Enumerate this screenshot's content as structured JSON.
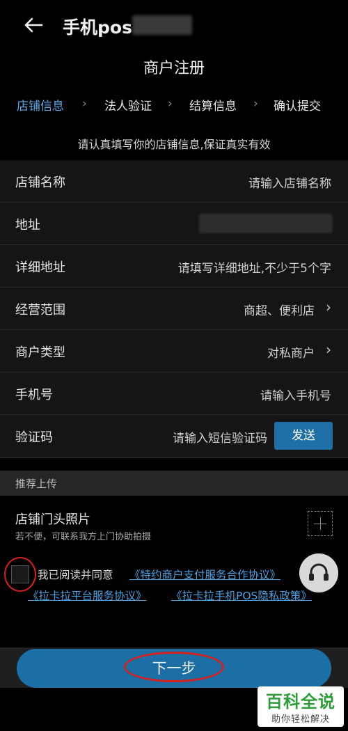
{
  "header": {
    "app_title": "手机pos",
    "page_title": "商户注册"
  },
  "steps": [
    {
      "label": "店铺信息",
      "active": true
    },
    {
      "label": "法人验证",
      "active": false
    },
    {
      "label": "结算信息",
      "active": false
    },
    {
      "label": "确认提交",
      "active": false
    }
  ],
  "hint": "请认真填写你的店铺信息,保证真实有效",
  "form": {
    "store_name": {
      "label": "店铺名称",
      "placeholder": "请输入店铺名称"
    },
    "address": {
      "label": "地址"
    },
    "detail_address": {
      "label": "详细地址",
      "placeholder": "请填写详细地址,不少于5个字"
    },
    "business_scope": {
      "label": "经营范围",
      "value": "商超、便利店"
    },
    "merchant_type": {
      "label": "商户类型",
      "value": "对私商户"
    },
    "phone": {
      "label": "手机号",
      "placeholder": "请输入手机号"
    },
    "code": {
      "label": "验证码",
      "placeholder": "请输入短信验证码",
      "send_label": "发送"
    }
  },
  "section": {
    "recommended_upload": "推荐上传"
  },
  "photo": {
    "title": "店铺门头照片",
    "subtitle": "若不便，可联系我方上门协助拍摄"
  },
  "agreement": {
    "prefix": "我已阅读并同意",
    "link1": "《特约商户支付服务合作协议》",
    "link2": "《拉卡拉平台服务协议》",
    "link3": "《拉卡拉手机POS隐私政策》"
  },
  "next_button": "下一步",
  "watermark": {
    "title": "百科全说",
    "subtitle": "助你轻松解决"
  },
  "colors": {
    "accent": "#1c6fa5",
    "link": "#4aa0e0",
    "highlight_ring": "#d42020"
  }
}
